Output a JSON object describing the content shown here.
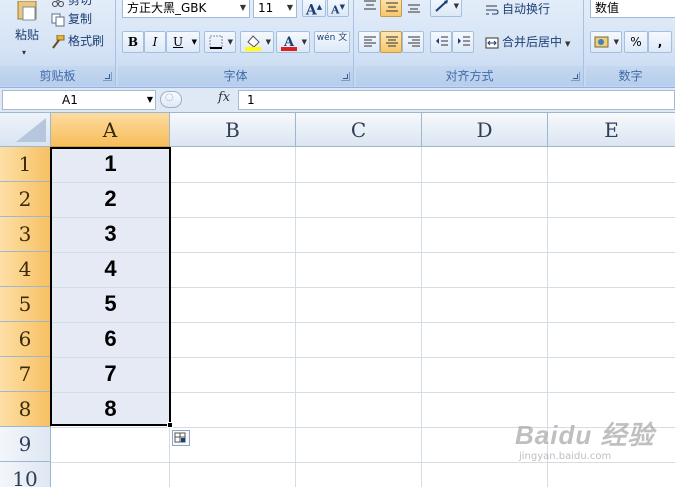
{
  "ribbon": {
    "clipboard": {
      "caption": "剪贴板",
      "paste_label": "粘贴",
      "cut_label": "剪切",
      "copy_label": "复制",
      "format_painter_label": "格式刷"
    },
    "font": {
      "caption": "字体",
      "font_name": "方正大黑_GBK",
      "font_size": "11",
      "bold_label": "B",
      "italic_label": "I",
      "underline_label": "U",
      "phonetic_label": "wén 文",
      "grow_label": "A",
      "shrink_label": "A"
    },
    "alignment": {
      "caption": "对齐方式",
      "wrap_text_label": "自动换行",
      "merge_center_label": "合并后居中"
    },
    "number": {
      "caption": "数字",
      "format_value": "数值",
      "percent_label": "%",
      "comma_label": ","
    }
  },
  "formula_bar": {
    "name_box": "A1",
    "fx_label": "fx",
    "formula_value": "1"
  },
  "grid": {
    "columns": [
      "A",
      "B",
      "C",
      "D",
      "E"
    ],
    "rows": [
      "1",
      "2",
      "3",
      "4",
      "5",
      "6",
      "7",
      "8",
      "9",
      "10"
    ],
    "column_a_values": [
      "1",
      "2",
      "3",
      "4",
      "5",
      "6",
      "7",
      "8"
    ],
    "selected_range": "A1:A8"
  },
  "watermark": {
    "main": "Baidu 经验",
    "sub": "jingyan.baidu.com"
  },
  "colors": {
    "selected_header": "#f7bd5a",
    "selection_fill": "#e6eaf5",
    "ribbon_blue": "#d5e3f5"
  }
}
